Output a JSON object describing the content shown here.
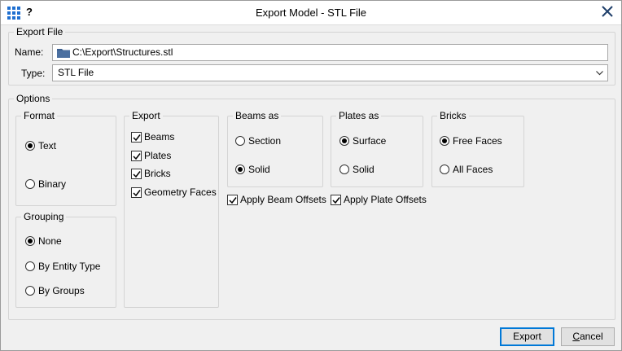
{
  "window": {
    "title": "Export Model - STL File",
    "help": "?"
  },
  "export_file": {
    "legend": "Export File",
    "name_label": "Name:",
    "name_value": "C:\\Export\\Structures.stl",
    "type_label": "Type:",
    "type_value": "STL File"
  },
  "options": {
    "legend": "Options",
    "format": {
      "legend": "Format",
      "text": "Text",
      "binary": "Binary",
      "selected": "Text"
    },
    "grouping": {
      "legend": "Grouping",
      "none": "None",
      "by_entity_type": "By Entity Type",
      "by_groups": "By Groups",
      "selected": "None"
    },
    "export": {
      "legend": "Export",
      "beams": "Beams",
      "plates": "Plates",
      "bricks": "Bricks",
      "geometry_faces": "Geometry Faces"
    },
    "beams_as": {
      "legend": "Beams as",
      "section": "Section",
      "solid": "Solid",
      "selected": "Solid"
    },
    "plates_as": {
      "legend": "Plates as",
      "surface": "Surface",
      "solid": "Solid",
      "selected": "Surface"
    },
    "bricks": {
      "legend": "Bricks",
      "free_faces": "Free Faces",
      "all_faces": "All Faces",
      "selected": "Free Faces"
    },
    "apply_beam_offsets": "Apply Beam Offsets",
    "apply_plate_offsets": "Apply Plate Offsets"
  },
  "buttons": {
    "export": "Export",
    "cancel_first": "C",
    "cancel_rest": "ancel"
  },
  "colors": {
    "accent": "#0078d7",
    "app_icon": "#1f6fd0",
    "folder": "#3b5f8f"
  }
}
